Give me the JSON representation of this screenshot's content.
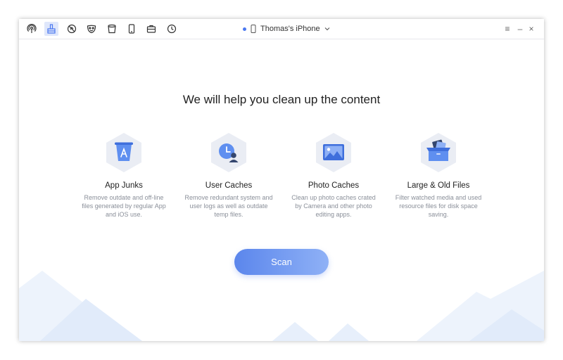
{
  "toolbar": {
    "icons": [
      "podcast-icon",
      "cleaner-icon",
      "blocked-icon",
      "mask-icon",
      "bin-icon",
      "phone-icon",
      "toolbox-icon",
      "history-icon"
    ],
    "active": "cleaner-icon"
  },
  "device": {
    "name": "Thomas's iPhone"
  },
  "window_controls": {
    "menu": "≡",
    "minimize": "–",
    "close": "×"
  },
  "main": {
    "headline": "We will help you clean up the content",
    "features": [
      {
        "title": "App Junks",
        "description": "Remove outdate and off-line files generated by regular App and iOS use.",
        "icon": "app-store-bin-icon"
      },
      {
        "title": "User Caches",
        "description": "Remove redundant system and user logs as well as outdate temp files.",
        "icon": "user-clock-icon"
      },
      {
        "title": "Photo Caches",
        "description": "Clean up photo caches crated by Camera and other photo editing apps.",
        "icon": "photo-icon"
      },
      {
        "title": "Large & Old Files",
        "description": "Filter watched media and used resource files for disk space saving.",
        "icon": "box-files-icon"
      }
    ],
    "scan_label": "Scan"
  },
  "colors": {
    "accent": "#4a78f0",
    "hex_bg": "#eaedf4",
    "mountain": "#e3edfb"
  }
}
